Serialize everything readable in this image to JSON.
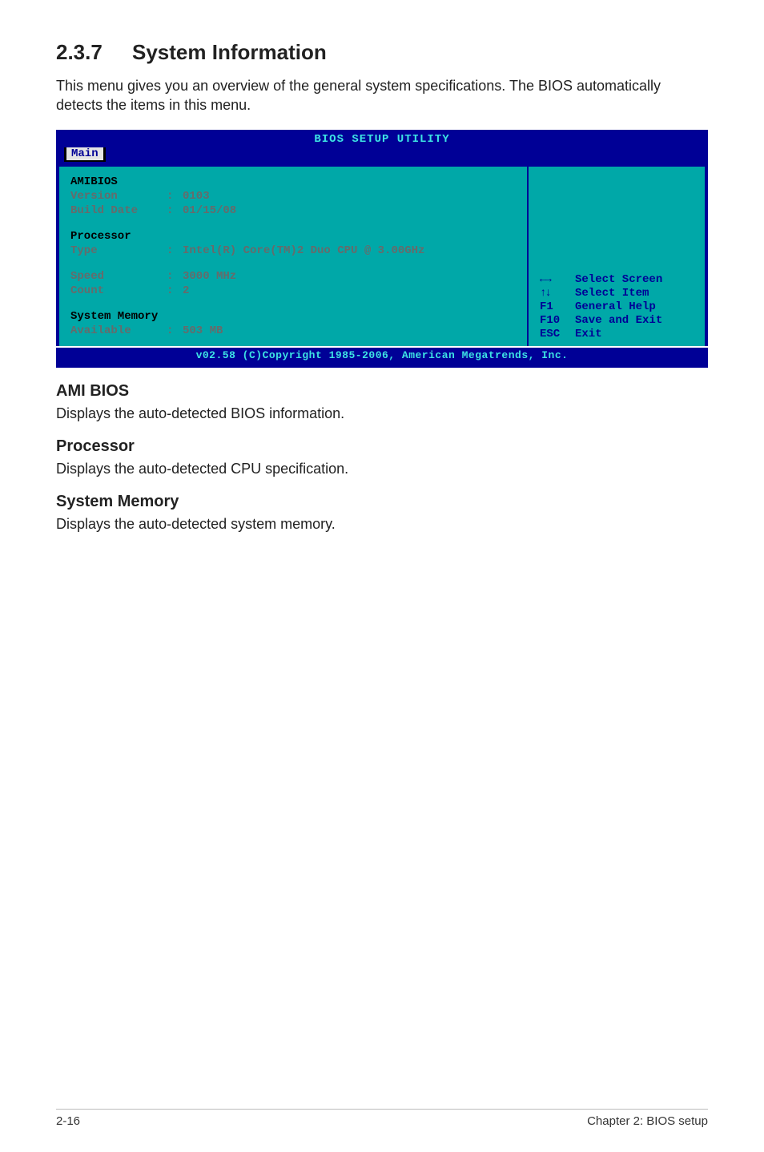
{
  "heading": {
    "number": "2.3.7",
    "title": "System Information"
  },
  "intro": "This menu gives you an overview of the general system specifications. The BIOS automatically detects the items in this menu.",
  "bios": {
    "title": "BIOS SETUP UTILITY",
    "tab": "Main",
    "left": {
      "amibios_label": "AMIBIOS",
      "version_k": "Version",
      "version_v": "0103",
      "builddate_k": "Build Date",
      "builddate_v": "01/15/08",
      "processor_label": "Processor",
      "type_k": "Type",
      "type_v": "Intel(R) Core(TM)2 Duo CPU @ 3.00GHz",
      "speed_k": "Speed",
      "speed_v": "3000 MHz",
      "count_k": "Count",
      "count_v": "2",
      "sysmem_label": "System Memory",
      "available_k": "Available",
      "available_v": "503 MB"
    },
    "help": {
      "lr": "Select Screen",
      "ud": "Select Item",
      "f1_k": "F1",
      "f1_v": "General Help",
      "f10_k": "F10",
      "f10_v": "Save and Exit",
      "esc_k": "ESC",
      "esc_v": "Exit"
    },
    "copyright": "v02.58 (C)Copyright 1985-2006, American Megatrends, Inc."
  },
  "sections": {
    "ami_h": "AMI BIOS",
    "ami_p": "Displays the auto-detected BIOS information.",
    "proc_h": "Processor",
    "proc_p": "Displays the auto-detected CPU specification.",
    "mem_h": "System Memory",
    "mem_p": "Displays the auto-detected system memory."
  },
  "footer": {
    "left": "2-16",
    "right": "Chapter 2: BIOS setup"
  }
}
